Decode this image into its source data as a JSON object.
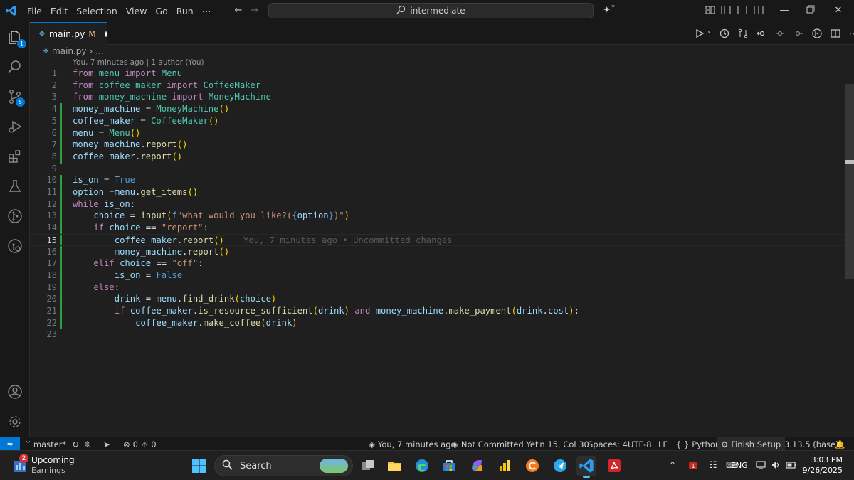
{
  "menubar": {
    "items": [
      "File",
      "Edit",
      "Selection",
      "View",
      "Go",
      "Run",
      "⋯"
    ],
    "command_center": "intermediate"
  },
  "activity": {
    "explorer_badge": "1",
    "scm_badge": "5"
  },
  "tab": {
    "filename": "main.py",
    "status": "M"
  },
  "breadcrumb": {
    "file": "main.py",
    "more": "..."
  },
  "codelens": "You, 7 minutes ago | 1 author (You)",
  "current_line": 15,
  "inline_blame": "You, 7 minutes ago • Uncommitted changes",
  "code_lines": [
    "from menu import Menu",
    "from coffee_maker import CoffeeMaker",
    "from money_machine import MoneyMachine",
    "money_machine = MoneyMachine()",
    "coffee_maker = CoffeeMaker()",
    "menu = Menu()",
    "money_machine.report()",
    "coffee_maker.report()",
    "",
    "is_on = True",
    "option =menu.get_items()",
    "while is_on:",
    "    choice = input(f\"what would you like?({option})\")",
    "    if choice == \"report\":",
    "        coffee_maker.report()",
    "        money_machine.report()",
    "    elif choice == \"off\":",
    "        is_on = False",
    "    else:",
    "        drink = menu.find_drink(choice)",
    "        if coffee_maker.is_resource_sufficient(drink) and money_machine.make_payment(drink.cost):",
    "            coffee_maker.make_coffee(drink)",
    ""
  ],
  "statusbar": {
    "branch": "master*",
    "errors": "0",
    "warnings": "0",
    "blame": "You, 7 minutes ago",
    "commit_state": "Not Committed Yet",
    "position": "Ln 15, Col 30",
    "spaces": "Spaces: 4",
    "encoding": "UTF-8",
    "eol": "LF",
    "language": "Python",
    "finish_setup": "Finish Setup",
    "interpreter": "3.13.5 (base)"
  },
  "taskbar": {
    "widget_badge": "2",
    "widget_title": "Upcoming",
    "widget_subtitle": "Earnings",
    "search_label": "Search",
    "language": "ENG",
    "time": "3:03 PM",
    "date": "9/26/2025"
  },
  "colors": {
    "accent": "#0078d4",
    "git_added": "#2ea043",
    "keyword": "#c586c0",
    "variable": "#9cdcfe",
    "class": "#4ec9b0",
    "function": "#dcdcaa",
    "string": "#ce9178"
  }
}
